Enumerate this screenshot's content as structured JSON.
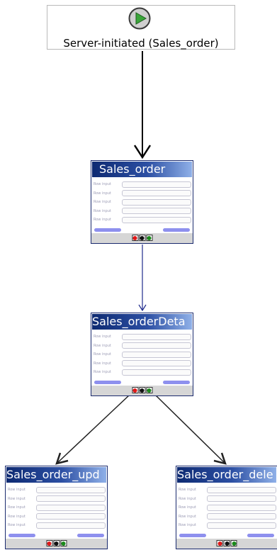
{
  "start_node": {
    "label": "Server-initiated (Sales_order)",
    "icon": "play-icon",
    "icon_color": "#3aa63a"
  },
  "forms": [
    {
      "id": "sales-order",
      "title": "Sales_order",
      "field_label": "Row input",
      "field_count": 5
    },
    {
      "id": "sales-order-detail",
      "title": "Sales_orderDeta",
      "field_label": "Row input",
      "field_count": 5
    },
    {
      "id": "sales-order-update",
      "title": "Sales_order_upd",
      "field_label": "Row input",
      "field_count": 5
    },
    {
      "id": "sales-order-delete",
      "title": "Sales_order_dele",
      "field_label": "Row input",
      "field_count": 5
    }
  ],
  "ports": {
    "colors": [
      "#e01818",
      "#111111",
      "#1a8a1a"
    ],
    "names": [
      "error-port",
      "cancel-port",
      "ok-port"
    ]
  },
  "edges": [
    {
      "from": "start",
      "to": "sales-order",
      "color": "#000000"
    },
    {
      "from": "sales-order",
      "to": "sales-order-detail",
      "color": "#1f2a8c"
    },
    {
      "from": "sales-order-detail",
      "to": "sales-order-update",
      "color": "#222222"
    },
    {
      "from": "sales-order-detail",
      "to": "sales-order-delete",
      "color": "#222222"
    }
  ]
}
